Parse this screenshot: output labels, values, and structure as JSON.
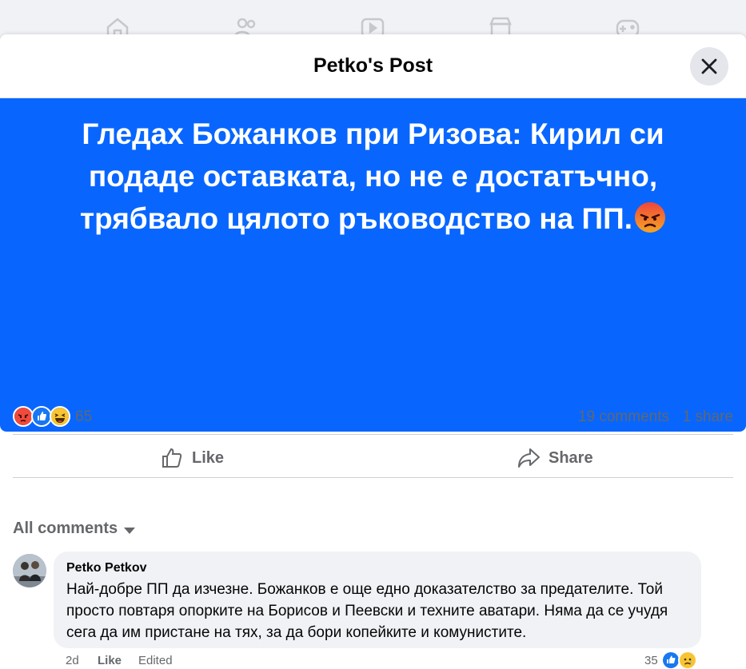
{
  "nav": {
    "icons": [
      "home-icon",
      "friends-icon",
      "video-icon",
      "marketplace-icon",
      "gaming-icon"
    ]
  },
  "modal": {
    "title": "Petko's Post",
    "close_icon": "close-icon"
  },
  "post": {
    "background_color": "#0866ff",
    "text": "Гледах Божанков при Ризова: Кирил си подаде оставката, но не е достатъчно, трябвало цялото ръководство на ПП.",
    "emoji": "angry-face-emoji"
  },
  "stats": {
    "reactions": [
      "angry",
      "like",
      "haha"
    ],
    "reaction_count": "65",
    "comments": "19 comments",
    "shares": "1 share"
  },
  "actions": {
    "like_label": "Like",
    "share_label": "Share"
  },
  "comments_filter": {
    "label": "All comments"
  },
  "comment": {
    "author": "Petko Petkov",
    "text": "Най-добре ПП да изчезне. Божанков е още едно доказателство за предателите. Той просто повтаря опорките на Борисов и Пеевски и техните аватари. Няма да се учудя сега да им пристане на тях, за да бори копейките и комунистите.",
    "time": "2d",
    "like_label": "Like",
    "edited_label": "Edited",
    "reaction_count": "35",
    "reactions": [
      "like",
      "sad"
    ]
  }
}
